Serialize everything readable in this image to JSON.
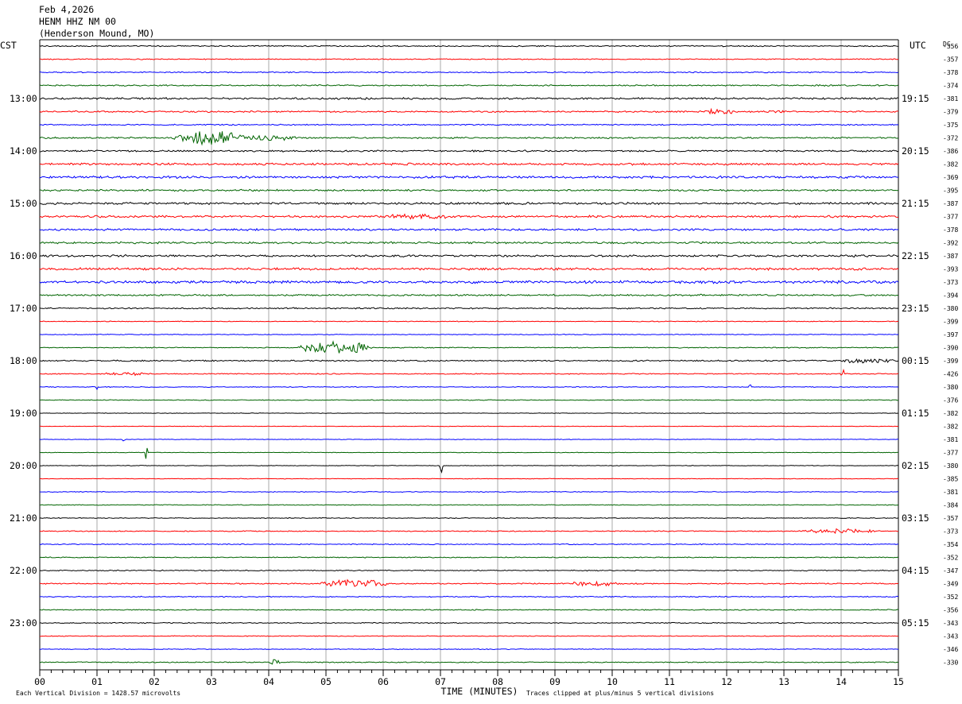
{
  "header": {
    "date": "Feb 4,2026",
    "station": "HENM HHZ NM 00",
    "location": "(Henderson Mound, MO)"
  },
  "chart_data": {
    "type": "line",
    "subtype": "helicorder",
    "left_zone_label": "CST",
    "right_zone_label": "UTC",
    "dc_label": "DC",
    "xlabel": "TIME (MINUTES)",
    "x_ticks": [
      "00",
      "01",
      "02",
      "03",
      "04",
      "05",
      "06",
      "07",
      "08",
      "09",
      "10",
      "11",
      "12",
      "13",
      "14",
      "15"
    ],
    "xlim": [
      0,
      15
    ],
    "footer_left": "Each Vertical Division = 1428.57 microvolts",
    "footer_right": "Traces clipped at plus/minus 5 vertical divisions",
    "left_time_labels": [
      {
        "trace": 4,
        "label": "13:00"
      },
      {
        "trace": 8,
        "label": "14:00"
      },
      {
        "trace": 12,
        "label": "15:00"
      },
      {
        "trace": 16,
        "label": "16:00"
      },
      {
        "trace": 20,
        "label": "17:00"
      },
      {
        "trace": 24,
        "label": "18:00"
      },
      {
        "trace": 28,
        "label": "19:00"
      },
      {
        "trace": 32,
        "label": "20:00"
      },
      {
        "trace": 36,
        "label": "21:00"
      },
      {
        "trace": 40,
        "label": "22:00"
      },
      {
        "trace": 44,
        "label": "23:00"
      }
    ],
    "right_time_labels": [
      {
        "trace": 4,
        "label": "19:15"
      },
      {
        "trace": 8,
        "label": "20:15"
      },
      {
        "trace": 12,
        "label": "21:15"
      },
      {
        "trace": 16,
        "label": "22:15"
      },
      {
        "trace": 20,
        "label": "23:15"
      },
      {
        "trace": 24,
        "label": "00:15"
      },
      {
        "trace": 28,
        "label": "01:15"
      },
      {
        "trace": 32,
        "label": "02:15"
      },
      {
        "trace": 36,
        "label": "03:15"
      },
      {
        "trace": 40,
        "label": "04:15"
      },
      {
        "trace": 44,
        "label": "05:15"
      }
    ],
    "dc_offsets": [
      -356,
      -357,
      -378,
      -374,
      -381,
      -379,
      -375,
      -372,
      -386,
      -382,
      -369,
      -395,
      -387,
      -377,
      -378,
      -392,
      -387,
      -393,
      -373,
      -394,
      -380,
      -399,
      -397,
      -390,
      -399,
      -426,
      -380,
      -376,
      -382,
      -382,
      -381,
      -377,
      -380,
      -385,
      -381,
      -384,
      -357,
      -373,
      -354,
      -352,
      -347,
      -349,
      -352,
      -356,
      -343,
      -343,
      -346,
      -330
    ],
    "trace_colors": [
      "#000000",
      "#ff0000",
      "#0000ff",
      "#006400"
    ],
    "trace_noise": [
      0.6,
      0.5,
      0.6,
      0.7,
      1.0,
      0.8,
      0.6,
      0.8,
      0.9,
      1.1,
      1.2,
      0.9,
      1.1,
      1.1,
      1.0,
      1.0,
      1.1,
      1.2,
      1.4,
      0.9,
      0.7,
      0.4,
      0.4,
      0.5,
      0.7,
      0.5,
      0.4,
      0.4,
      0.3,
      0.3,
      0.3,
      0.3,
      0.3,
      0.3,
      0.4,
      0.4,
      0.4,
      0.5,
      0.5,
      0.5,
      0.5,
      0.6,
      0.5,
      0.5,
      0.5,
      0.4,
      0.4,
      0.5
    ],
    "events": [
      {
        "trace": 5,
        "start": 11.6,
        "end": 12.2,
        "amp": 3
      },
      {
        "trace": 5,
        "start": 12.7,
        "end": 13.1,
        "amp": 2
      },
      {
        "trace": 7,
        "start": 2.3,
        "end": 3.6,
        "amp": 11
      },
      {
        "trace": 7,
        "start": 3.6,
        "end": 4.5,
        "amp": 3
      },
      {
        "trace": 13,
        "start": 6.0,
        "end": 7.2,
        "amp": 3
      },
      {
        "trace": 23,
        "start": 4.5,
        "end": 5.8,
        "amp": 8
      },
      {
        "trace": 24,
        "start": 14.0,
        "end": 15.0,
        "amp": 3
      },
      {
        "trace": 25,
        "start": 1.1,
        "end": 2.0,
        "amp": 2
      },
      {
        "trace": 25,
        "start": 14.0,
        "end": 14.05,
        "amp": 16
      },
      {
        "trace": 26,
        "start": 1.0,
        "end": 1.02,
        "amp": 5
      },
      {
        "trace": 26,
        "start": 12.4,
        "end": 12.42,
        "amp": 4
      },
      {
        "trace": 30,
        "start": 1.45,
        "end": 1.47,
        "amp": 3
      },
      {
        "trace": 31,
        "start": 1.85,
        "end": 1.88,
        "amp": 14
      },
      {
        "trace": 32,
        "start": 7.0,
        "end": 7.05,
        "amp": 16
      },
      {
        "trace": 37,
        "start": 13.3,
        "end": 14.7,
        "amp": 3
      },
      {
        "trace": 41,
        "start": 4.9,
        "end": 6.1,
        "amp": 6
      },
      {
        "trace": 41,
        "start": 9.2,
        "end": 10.2,
        "amp": 3
      },
      {
        "trace": 47,
        "start": 4.0,
        "end": 4.2,
        "amp": 4
      }
    ]
  }
}
